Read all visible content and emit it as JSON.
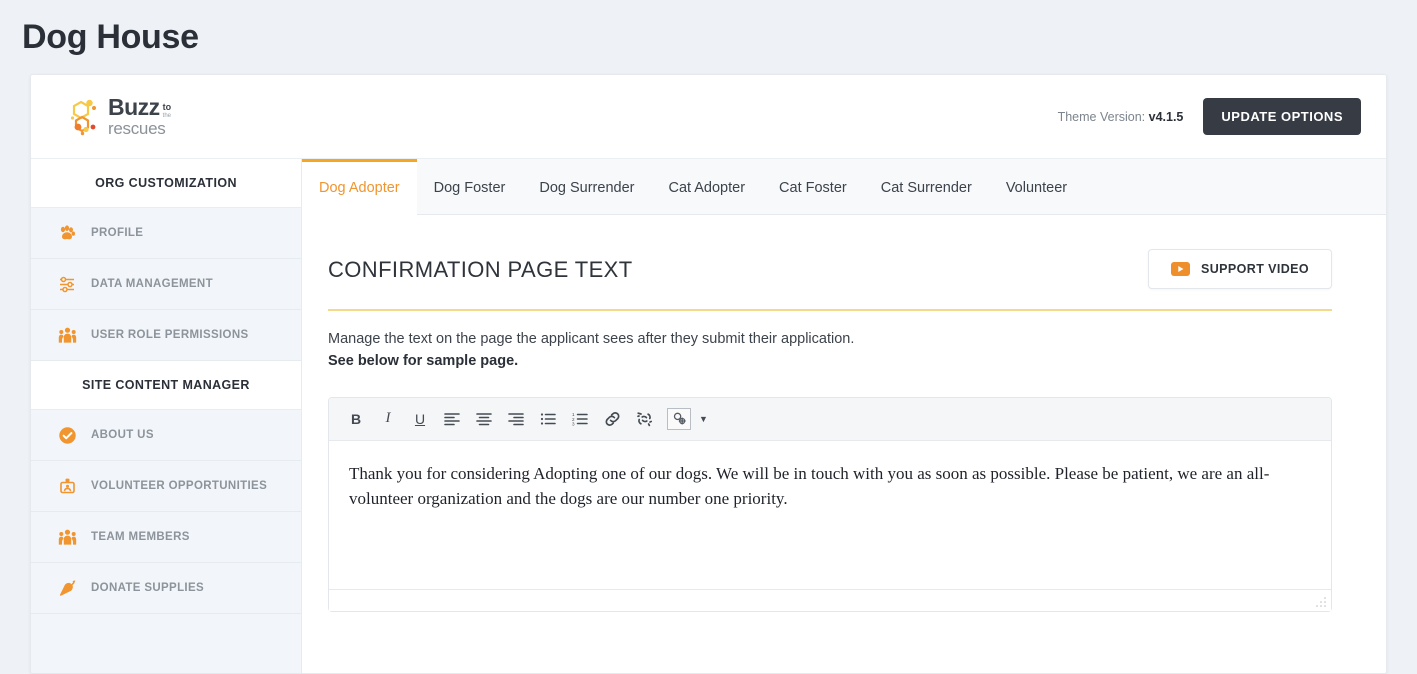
{
  "page": {
    "title": "Dog House"
  },
  "header": {
    "logo_alt": "Buzz to the rescues",
    "logo_text_main": "Buzz",
    "logo_text_sub1": "to",
    "logo_text_sub2": "the",
    "logo_text_bottom": "rescues",
    "theme_version_label": "Theme Version:",
    "theme_version_value": "v4.1.5",
    "update_button": "UPDATE OPTIONS"
  },
  "sidebar": {
    "sections": [
      {
        "header": "ORG CUSTOMIZATION",
        "items": [
          {
            "label": "PROFILE",
            "icon": "paw-icon"
          },
          {
            "label": "DATA MANAGEMENT",
            "icon": "sliders-icon"
          },
          {
            "label": "USER ROLE PERMISSIONS",
            "icon": "users-group-icon"
          }
        ]
      },
      {
        "header": "SITE CONTENT MANAGER",
        "items": [
          {
            "label": "ABOUT US",
            "icon": "check-circle-icon"
          },
          {
            "label": "VOLUNTEER OPPORTUNITIES",
            "icon": "id-badge-icon"
          },
          {
            "label": "TEAM MEMBERS",
            "icon": "users-group-icon"
          },
          {
            "label": "DONATE SUPPLIES",
            "icon": "carrot-icon"
          }
        ]
      }
    ]
  },
  "tabs": [
    {
      "label": "Dog Adopter",
      "active": true
    },
    {
      "label": "Dog Foster",
      "active": false
    },
    {
      "label": "Dog Surrender",
      "active": false
    },
    {
      "label": "Cat Adopter",
      "active": false
    },
    {
      "label": "Cat Foster",
      "active": false
    },
    {
      "label": "Cat Surrender",
      "active": false
    },
    {
      "label": "Volunteer",
      "active": false
    }
  ],
  "main": {
    "section_title": "CONFIRMATION PAGE TEXT",
    "support_button": "SUPPORT VIDEO",
    "description_line1": "Manage the text on the page the applicant sees after they submit their application.",
    "description_line2": "See below for sample page.",
    "editor": {
      "toolbar": [
        {
          "name": "bold",
          "glyph": "B"
        },
        {
          "name": "italic",
          "glyph": "I"
        },
        {
          "name": "underline",
          "glyph": "U"
        },
        {
          "name": "align-left",
          "glyph": ""
        },
        {
          "name": "align-center",
          "glyph": ""
        },
        {
          "name": "align-right",
          "glyph": ""
        },
        {
          "name": "bullet-list",
          "glyph": ""
        },
        {
          "name": "numbered-list",
          "glyph": ""
        },
        {
          "name": "insert-link",
          "glyph": ""
        },
        {
          "name": "remove-link",
          "glyph": ""
        },
        {
          "name": "source-tools",
          "glyph": ""
        }
      ],
      "content": "Thank you for considering Adopting one of our dogs. We will be in touch with you as soon as possible. Please be patient, we are an all-volunteer organization and the dogs are our number one priority."
    }
  },
  "colors": {
    "accent_orange": "#f0952f",
    "tab_active": "#f5a623",
    "divider_gold": "#f5d98a",
    "dark_button": "#373c44",
    "page_bg": "#eef2f6",
    "sidebar_bg": "#f2f6fa"
  }
}
